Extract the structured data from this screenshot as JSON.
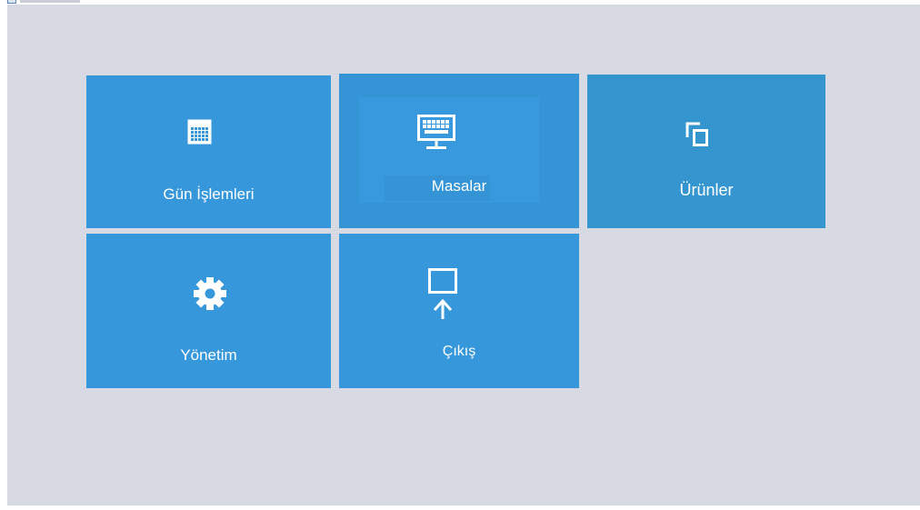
{
  "window": {
    "title_icon": "app-window-icon"
  },
  "tiles": [
    {
      "id": "gun",
      "label": "Gün İşlemleri",
      "icon": "calendar-icon"
    },
    {
      "id": "masalar",
      "label": "Masalar",
      "icon": "keyboard-monitor-icon"
    },
    {
      "id": "urunler",
      "label": "Ürünler",
      "icon": "copy-icon"
    },
    {
      "id": "yonetim",
      "label": "Yönetim",
      "icon": "gear-icon"
    },
    {
      "id": "cikis",
      "label": "Çıkış",
      "icon": "monitor-upload-icon"
    }
  ],
  "colors": {
    "background": "#d7dae3",
    "tile": "#3797db",
    "tile_text": "#ffffff"
  }
}
